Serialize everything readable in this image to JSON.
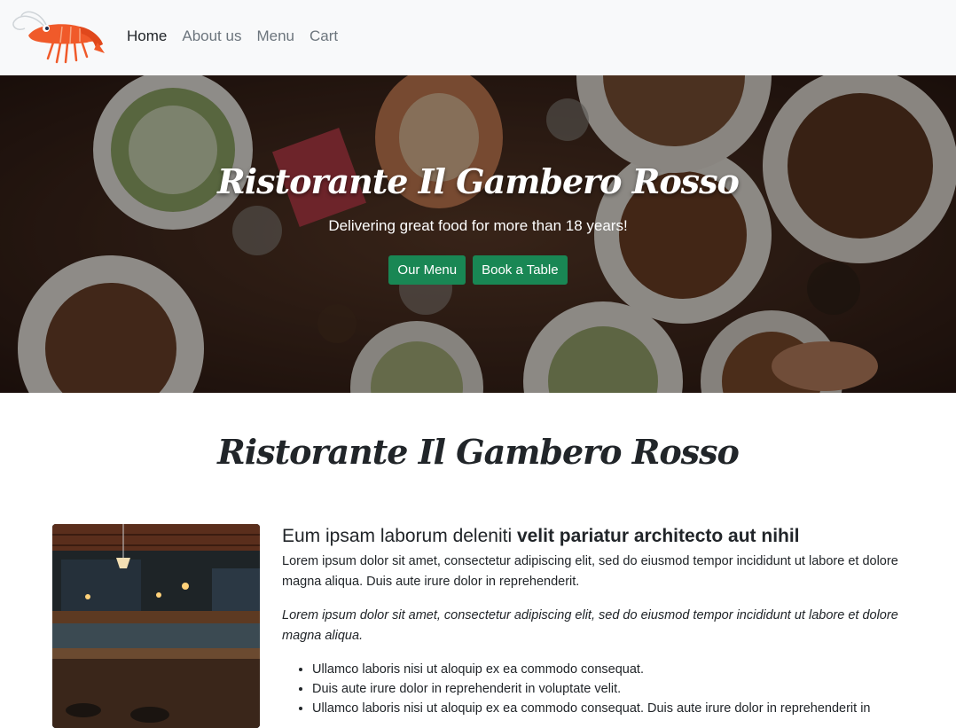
{
  "navbar": {
    "logo_icon": "shrimp-logo-icon",
    "links": [
      {
        "label": "Home",
        "active": true
      },
      {
        "label": "About us",
        "active": false
      },
      {
        "label": "Menu",
        "active": false
      },
      {
        "label": "Cart",
        "active": false
      }
    ]
  },
  "hero": {
    "title": "Ristorante Il Gambero Rosso",
    "subtitle": "Delivering great food for more than 18 years!",
    "buttons": {
      "menu_label": "Our Menu",
      "book_label": "Book a Table"
    }
  },
  "about": {
    "title": "Ristorante Il Gambero Rosso",
    "heading_normal": "Eum ipsam laborum deleniti ",
    "heading_bold": "velit pariatur architecto aut nihil",
    "paragraph": "Lorem ipsum dolor sit amet, consectetur adipiscing elit, sed do eiusmod tempor incididunt ut labore et dolore magna aliqua. Duis aute irure dolor in reprehenderit.",
    "italic_paragraph": "Lorem ipsum dolor sit amet, consectetur adipiscing elit, sed do eiusmod tempor incididunt ut labore et dolore magna aliqua.",
    "list": [
      "Ullamco laboris nisi ut aloquip ex ea commodo consequat.",
      "Duis aute irure dolor in reprehenderit in voluptate velit.",
      "Ullamco laboris nisi ut aloquip ex ea commodo consequat. Duis aute irure dolor in reprehenderit in"
    ]
  },
  "colors": {
    "accent_green": "#198754",
    "navbar_bg": "#f8f9fa"
  }
}
